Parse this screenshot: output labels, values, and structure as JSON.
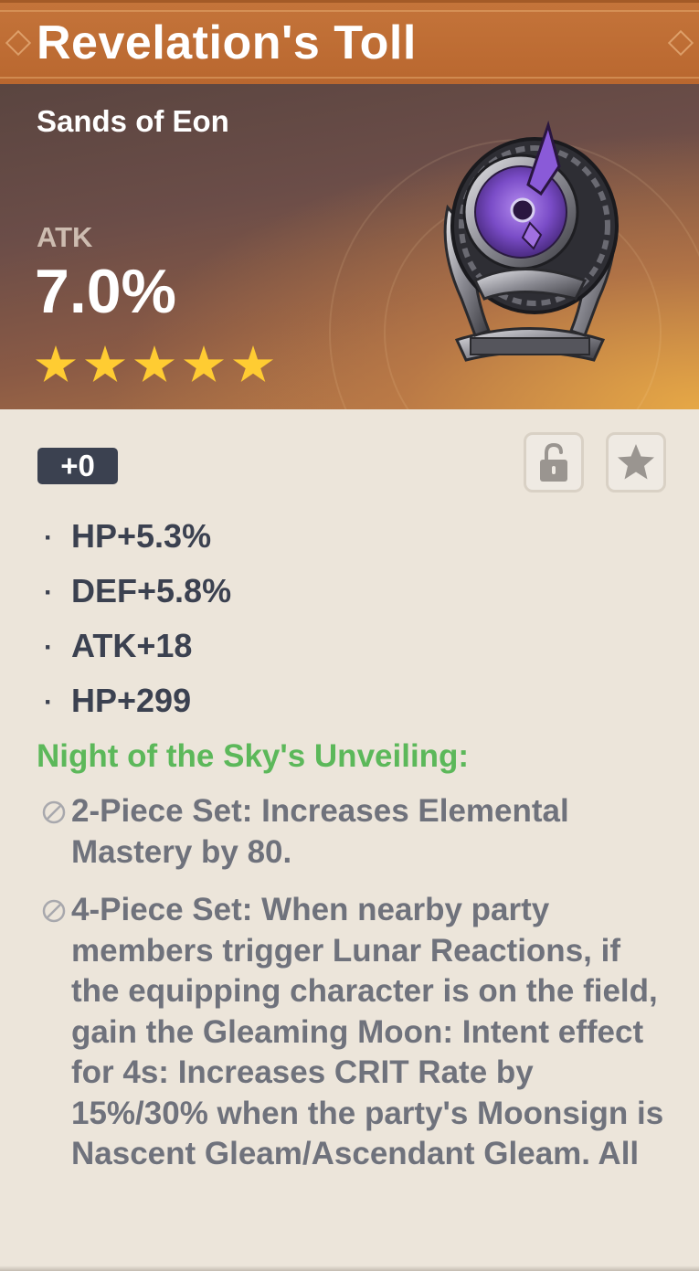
{
  "header": {
    "title": "Revelation's Toll"
  },
  "hero": {
    "artifact_type": "Sands of Eon",
    "main_stat_label": "ATK",
    "main_stat_value": "7.0%",
    "rarity_stars": 5,
    "artifact_icon": "sands-artifact-icon"
  },
  "details": {
    "level": "+0",
    "lock_icon": "unlocked-padlock-icon",
    "favorite_icon": "star-icon",
    "substats": [
      "HP+5.3%",
      "DEF+5.8%",
      "ATK+18",
      "HP+299"
    ],
    "set_name": "Night of the Sky's Unveiling:",
    "set_effects": [
      "2-Piece Set: Increases Elemental Mastery by 80.",
      "4-Piece Set: When nearby party members trigger Lunar Reactions, if the equipping character is on the field, gain the Gleaming Moon: Intent effect for 4s: Increases CRIT Rate by 15%/30% when the party's Moonsign is Nascent Gleam/Ascendant Gleam. All"
    ]
  },
  "colors": {
    "title_bar": "#c4743a",
    "set_name": "#5cb85a",
    "star": "#ffcc32",
    "badge_bg": "#3b4150",
    "body_bg": "#ece5da",
    "effect_text": "#6f727c"
  }
}
